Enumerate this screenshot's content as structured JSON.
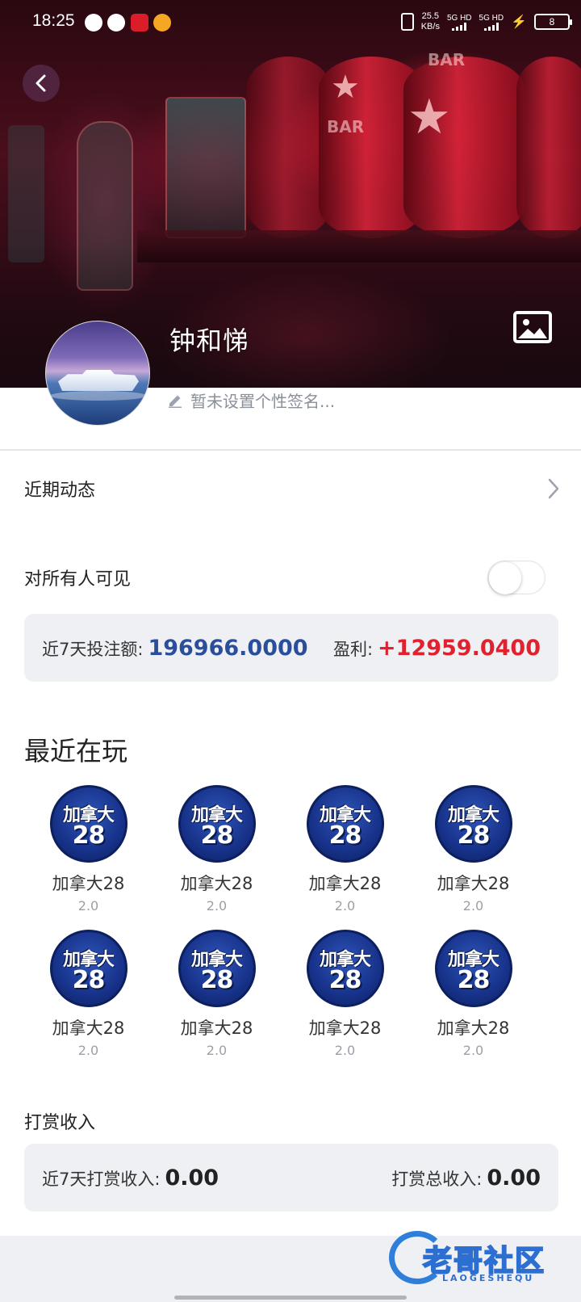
{
  "status_bar": {
    "time": "18:25",
    "net_speed": "25.5",
    "net_unit": "KB/s",
    "sim1": "5G HD",
    "sim2": "5G HD",
    "battery": "8"
  },
  "profile": {
    "name": "钟和悌",
    "signature": "暂未设置个性签名..."
  },
  "rows": {
    "recent_activity": "近期动态",
    "visible_to_all": "对所有人可见",
    "visible_to_all_on": false
  },
  "bet_stats": {
    "bet_label": "近7天投注额:",
    "bet_value": "196966.0000",
    "profit_label": "盈利:",
    "profit_value": "+12959.0400"
  },
  "recent_games": {
    "title": "最近在玩",
    "items": [
      {
        "name": "加拿大28",
        "version": "2.0",
        "logo_line1": "加拿大",
        "logo_line2": "28"
      },
      {
        "name": "加拿大28",
        "version": "2.0",
        "logo_line1": "加拿大",
        "logo_line2": "28"
      },
      {
        "name": "加拿大28",
        "version": "2.0",
        "logo_line1": "加拿大",
        "logo_line2": "28"
      },
      {
        "name": "加拿大28",
        "version": "2.0",
        "logo_line1": "加拿大",
        "logo_line2": "28"
      },
      {
        "name": "加拿大28",
        "version": "2.0",
        "logo_line1": "加拿大",
        "logo_line2": "28"
      },
      {
        "name": "加拿大28",
        "version": "2.0",
        "logo_line1": "加拿大",
        "logo_line2": "28"
      },
      {
        "name": "加拿大28",
        "version": "2.0",
        "logo_line1": "加拿大",
        "logo_line2": "28"
      },
      {
        "name": "加拿大28",
        "version": "2.0",
        "logo_line1": "加拿大",
        "logo_line2": "28"
      }
    ]
  },
  "tips": {
    "title": "打赏收入",
    "recent_label": "近7天打赏收入:",
    "recent_value": "0.00",
    "total_label": "打赏总收入:",
    "total_value": "0.00"
  },
  "watermark": {
    "text": "老哥社区",
    "sub": "LAOGESHEQU"
  },
  "colors": {
    "bet_value": "#2a4e9c",
    "profit_value": "#e0212e",
    "card_bg": "#eef0f4"
  }
}
